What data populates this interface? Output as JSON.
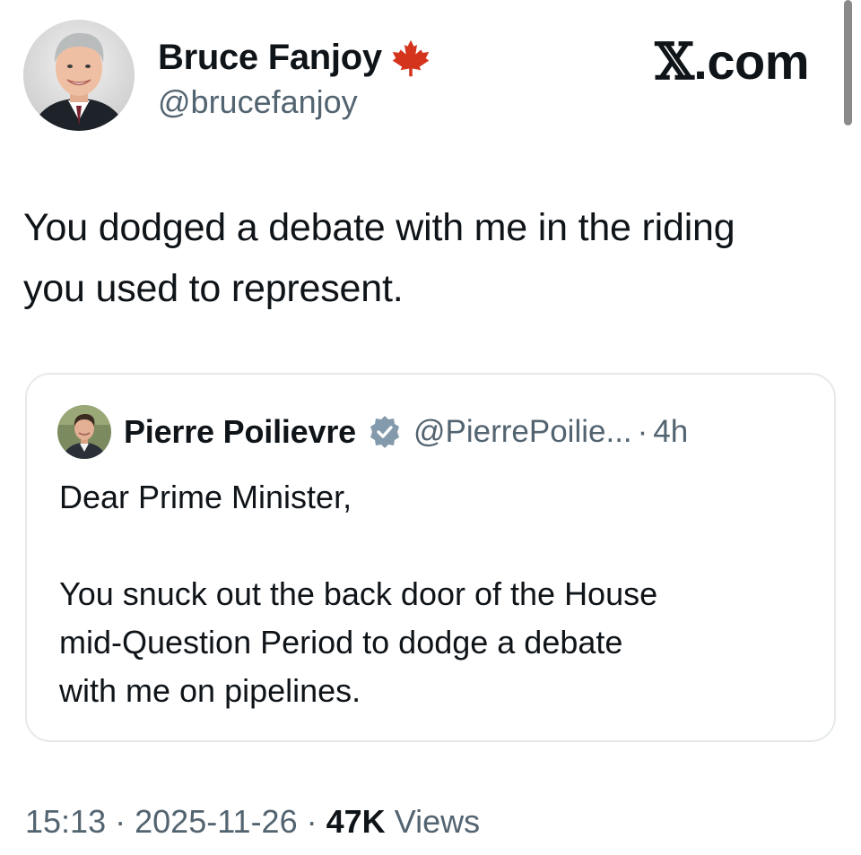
{
  "site": {
    "brand_x": "𝕏",
    "brand_suffix": ".com"
  },
  "author": {
    "name": "Bruce Fanjoy",
    "handle": "@brucefanjoy",
    "avatar_icon": "avatar-photo",
    "badge_icon": "maple-leaf-icon",
    "badge_color": "#d4331c"
  },
  "tweet": {
    "text_line1": "You dodged a debate with me in the riding",
    "text_line2": "you used to represent."
  },
  "quoted_tweet": {
    "author_name": "Pierre Poilievre",
    "verified_icon": "verified-badge-icon",
    "verified_color": "#829aab",
    "handle": "@PierrePoilie...",
    "separator": "·",
    "time": "4h",
    "para1": "Dear Prime Minister,",
    "para2_line1": "You snuck out the back door of the House",
    "para2_line2": "mid-Question Period to dodge a debate",
    "para2_line3": "with me on pipelines."
  },
  "meta": {
    "time": "15:13",
    "sep1": "·",
    "date": "2025-11-26",
    "sep2": "·",
    "views_count": "47K",
    "views_label": "Views"
  },
  "colors": {
    "text_primary": "#0f1419",
    "text_secondary": "#536471",
    "card_border": "#e6e9ec"
  }
}
